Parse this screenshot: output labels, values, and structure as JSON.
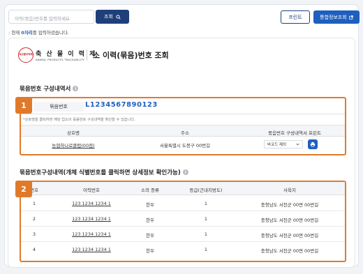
{
  "search": {
    "placeholder": "이력(묶음)번호를 입력하세요",
    "button_label": "조회"
  },
  "header_buttons": {
    "print_label": "프린트",
    "integrated_label": "통합정보조회"
  },
  "hint": {
    "prefix": ": 현재 ",
    "highlight": "0자리",
    "suffix": "를 입력하셨습니다."
  },
  "logo": {
    "seal_text": "축산물이력제",
    "main": "축 산 물 이 력 제",
    "sub": "ANIMAL PRODUCTS TRACEABILITY"
  },
  "page_title": "소 이력(묶음)번호 조회",
  "section1": {
    "title": "묶음번호 구성내역서",
    "badge": "1",
    "bundle_label": "묶음번호",
    "bundle_no": "L1234567890123",
    "notice": "*상호명을 클릭하면 해당 업소의 묶음번호 구성내역을 확인할 수 있습니다.",
    "columns": [
      "상호명",
      "주소",
      "묶음번호 구성내역서 프린트"
    ],
    "row": {
      "name": "농협하나로클럽(00점)",
      "address": "서울특별시 도봉구 00번길",
      "select_value": "바코드 제외"
    }
  },
  "section2": {
    "title": "묶음번호구성내역(개체 식별번호를 클릭하면 상세정보 확인가능)",
    "badge": "2",
    "columns": [
      "번호",
      "이력번호",
      "소의 종류",
      "등급(근내지방도)",
      "사육지"
    ],
    "rows": [
      {
        "no": "1",
        "trace": "123 1234 1234 1",
        "kind": "한우",
        "grade": "1",
        "farm": "충청남도 서천군 00면 00번길"
      },
      {
        "no": "2",
        "trace": "123 1234 1234 1",
        "kind": "한우",
        "grade": "1",
        "farm": "충청남도 서천군 00면 00번길"
      },
      {
        "no": "3",
        "trace": "123 1234 1234 1",
        "kind": "한우",
        "grade": "1",
        "farm": "충청남도 서천군 00면 00번길"
      },
      {
        "no": "4",
        "trace": "123 1234 1234 1",
        "kind": "한우",
        "grade": "1",
        "farm": "충청남도 서천군 00면 00번길"
      }
    ]
  },
  "colors": {
    "primary": "#1f3f7a",
    "accent": "#1f5fbf",
    "highlight_border": "#e07a2a",
    "seal": "#d2252b"
  },
  "icons": {
    "search": "search-icon",
    "external": "external-link-icon",
    "print": "printer-icon",
    "info": "info-icon",
    "chevron": "chevron-down-icon"
  }
}
